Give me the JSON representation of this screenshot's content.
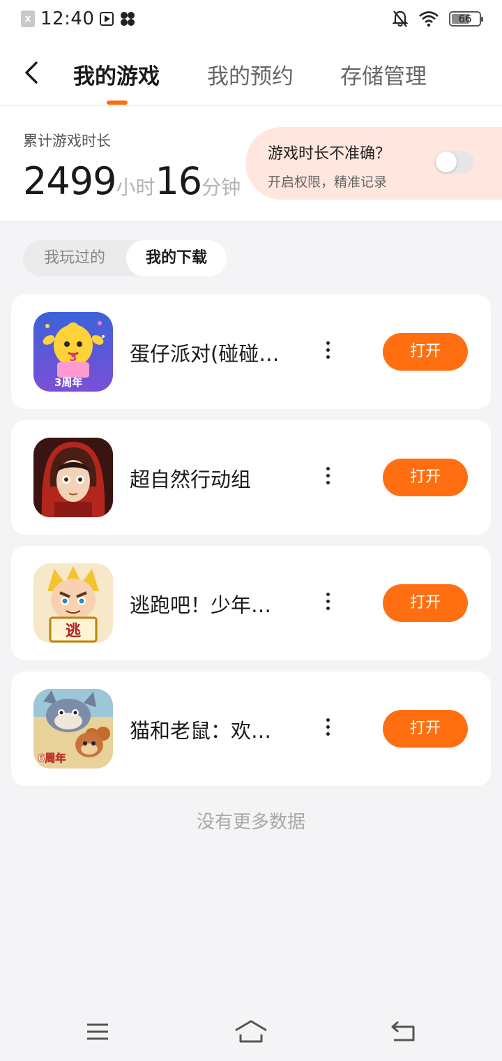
{
  "status_bar": {
    "time": "12:40",
    "battery": "66",
    "app_badge": "x"
  },
  "header": {
    "tabs": [
      {
        "label": "我的游戏",
        "active": true
      },
      {
        "label": "我的预约",
        "active": false
      },
      {
        "label": "存储管理",
        "active": false
      }
    ],
    "accent_color": "#ff6a13"
  },
  "summary": {
    "label": "累计游戏时长",
    "hours": "2499",
    "hours_unit": "小时",
    "minutes": "16",
    "minutes_unit": "分钟",
    "notice_title": "游戏时长不准确？",
    "notice_subtitle": "开启权限，精准记录",
    "toggle_on": false
  },
  "filter": {
    "options": [
      {
        "label": "我玩过的",
        "selected": false
      },
      {
        "label": "我的下载",
        "selected": true
      }
    ]
  },
  "games": [
    {
      "name": "蛋仔派对(碰碰…",
      "action": "打开",
      "icon": "eggy-party-icon",
      "badge": "3周年"
    },
    {
      "name": "超自然行动组",
      "action": "打开",
      "icon": "hooded-girl-icon"
    },
    {
      "name": "逃跑吧！少年…",
      "action": "打开",
      "icon": "runaway-boy-icon",
      "badge": "逃"
    },
    {
      "name": "猫和老鼠：欢…",
      "action": "打开",
      "icon": "tom-and-jerry-icon",
      "badge": "6周年"
    }
  ],
  "footer": {
    "no_more": "没有更多数据"
  }
}
